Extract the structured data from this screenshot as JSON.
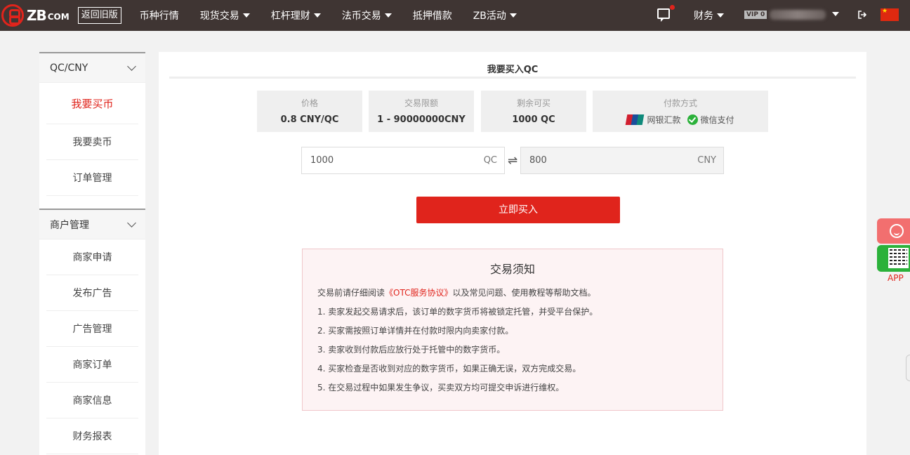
{
  "header": {
    "logo_text": "ZB",
    "logo_suffix": "COM",
    "old_version_label": "返回旧版",
    "nav": [
      {
        "label": "币种行情",
        "dropdown": false
      },
      {
        "label": "现货交易",
        "dropdown": true
      },
      {
        "label": "杠杆理财",
        "dropdown": true
      },
      {
        "label": "法币交易",
        "dropdown": true
      },
      {
        "label": "抵押借款",
        "dropdown": false
      },
      {
        "label": "ZB活动",
        "dropdown": true
      }
    ],
    "finance_label": "财务",
    "vip_label": "VIP 0",
    "icons": [
      "message-icon",
      "logout-icon",
      "china-flag-icon"
    ]
  },
  "sidebar": {
    "groups": [
      {
        "title": "QC/CNY",
        "items": [
          {
            "label": "我要买币",
            "active": true
          },
          {
            "label": "我要卖币",
            "active": false
          },
          {
            "label": "订单管理",
            "active": false
          }
        ]
      },
      {
        "title": "商户管理",
        "items": [
          {
            "label": "商家申请",
            "active": false
          },
          {
            "label": "发布广告",
            "active": false
          },
          {
            "label": "广告管理",
            "active": false
          },
          {
            "label": "商家订单",
            "active": false
          },
          {
            "label": "商家信息",
            "active": false
          },
          {
            "label": "财务报表",
            "active": false
          }
        ]
      }
    ]
  },
  "main": {
    "title": "我要买入QC",
    "info": {
      "price": {
        "label": "价格",
        "value": "0.8 CNY/QC"
      },
      "limit": {
        "label": "交易限额",
        "value": "1 - 90000000CNY"
      },
      "remaining": {
        "label": "剩余可买",
        "value": "1000 QC"
      },
      "payment": {
        "label": "付款方式",
        "methods": [
          "网银汇款",
          "微信支付"
        ]
      }
    },
    "qc_input": {
      "value": "1000",
      "unit": "QC"
    },
    "cny_input": {
      "value": "800",
      "unit": "CNY"
    },
    "buy_button": "立即买入",
    "notice": {
      "title": "交易须知",
      "intro_before": "交易前请仔细阅读",
      "intro_link": "《OTC服务协议》",
      "intro_after": "以及常见问题、使用教程等帮助文档。",
      "lines": [
        "1. 卖家发起交易请求后，该订单的数字货币将被锁定托管，并受平台保护。",
        "2. 买家需按照订单详情并在付款时限内向卖家付款。",
        "3. 卖家收到付款后应放行处于托管中的数字货币。",
        "4. 买家检查是否收到对应的数字货币，如果正确无误，双方完成交易。",
        "5. 在交易过程中如果发生争议，买卖双方均可提交申诉进行维权。"
      ]
    }
  },
  "float": {
    "app_label": "APP"
  },
  "colors": {
    "brand_red": "#e0241c",
    "topbar": "#3f3533",
    "wechat_green": "#2bb13a"
  }
}
